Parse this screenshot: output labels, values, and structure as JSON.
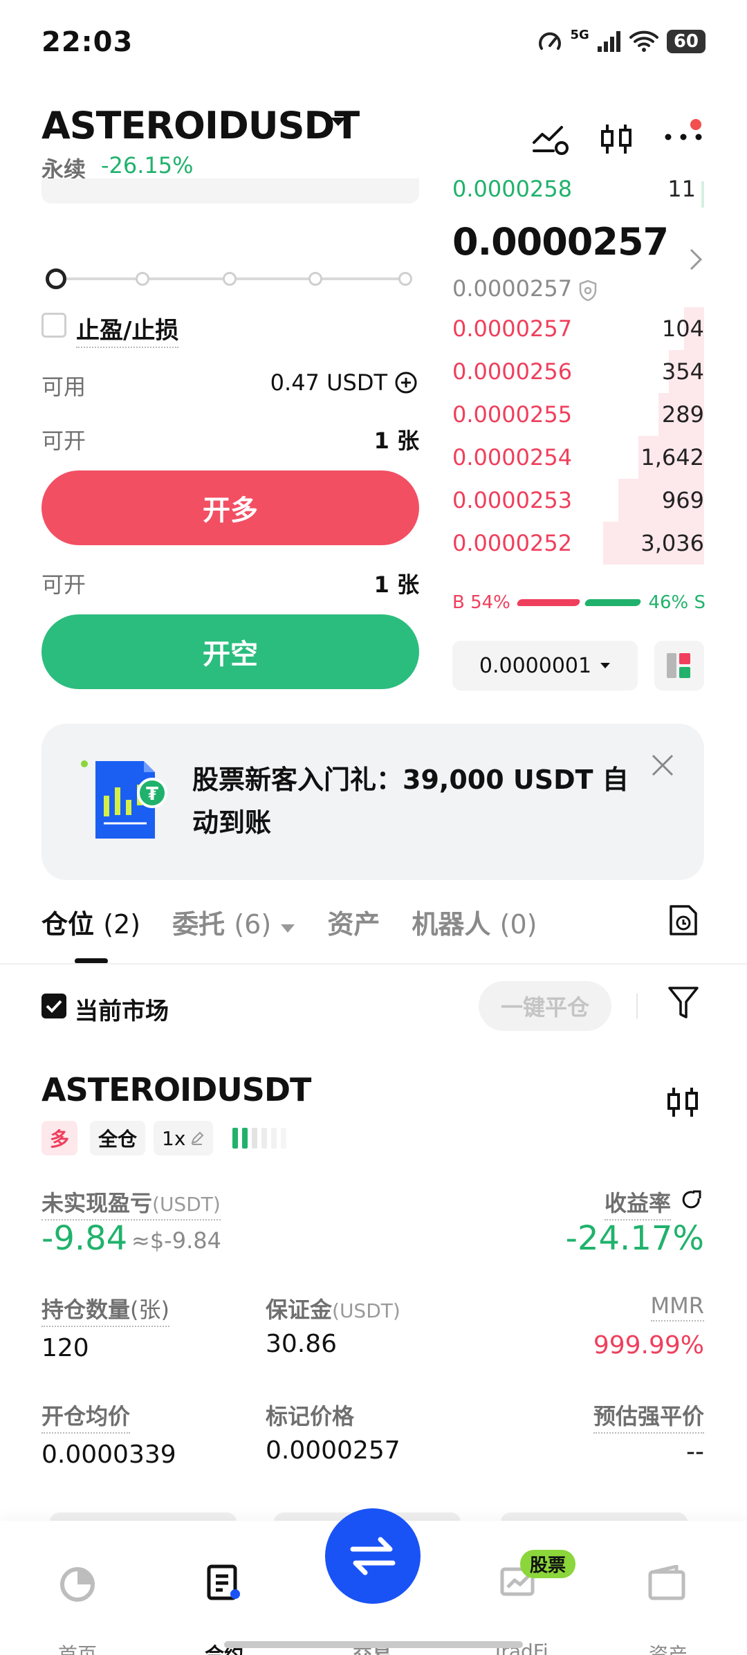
{
  "status_bar": {
    "time": "22:03",
    "network": "5G",
    "battery": "60"
  },
  "header": {
    "pair": "ASTEROIDUSDT",
    "perp_label": "永续",
    "change": "-26.15%"
  },
  "order_form": {
    "tp_sl_label": "止盈/止损",
    "available_label": "可用",
    "available_value": "0.47 USDT",
    "can_open_label": "可开",
    "can_open_long": "1 张",
    "can_open_short": "1 张",
    "long_button": "开多",
    "short_button": "开空",
    "leverage_slider_fraction": 0
  },
  "order_book": {
    "top_ask_price": "0.0000258",
    "top_ask_qty": "11",
    "last_price": "0.0000257",
    "mark_price": "0.0000257",
    "bids": [
      {
        "price": "0.0000257",
        "qty": "104",
        "depth": 0.08
      },
      {
        "price": "0.0000256",
        "qty": "354",
        "depth": 0.14
      },
      {
        "price": "0.0000255",
        "qty": "289",
        "depth": 0.18
      },
      {
        "price": "0.0000254",
        "qty": "1,642",
        "depth": 0.26
      },
      {
        "price": "0.0000253",
        "qty": "969",
        "depth": 0.34
      },
      {
        "price": "0.0000252",
        "qty": "3,036",
        "depth": 0.4
      }
    ],
    "buy_ratio": "B 54%",
    "sell_ratio": "46% S",
    "tick_size": "0.0000001"
  },
  "banner": {
    "text": "股票新客入门礼：39,000 USDT 自动到账"
  },
  "tabs": [
    {
      "label": "仓位",
      "count": "(2)"
    },
    {
      "label": "委托",
      "count": "(6)"
    },
    {
      "label": "资产",
      "count": ""
    },
    {
      "label": "机器人",
      "count": "(0)"
    }
  ],
  "filter": {
    "current_market_label": "当前市场",
    "close_all_label": "一键平仓"
  },
  "position": {
    "symbol": "ASTEROIDUSDT",
    "side_tag": "多",
    "margin_mode_tag": "全仓",
    "leverage_tag": "1x",
    "unrealized_pnl_label": "未实现盈亏",
    "unrealized_pnl_unit": "(USDT)",
    "unrealized_pnl": "-9.84",
    "unrealized_pnl_usd": "≈$-9.84",
    "roe_label": "收益率",
    "roe": "-24.17%",
    "size_label": "持仓数量",
    "size_unit": "(张)",
    "size": "120",
    "margin_label": "保证金",
    "margin_unit": "(USDT)",
    "margin": "30.86",
    "mmr_label": "MMR",
    "mmr": "999.99%",
    "entry_label": "开仓均价",
    "entry": "0.0000339",
    "mark_label": "标记价格",
    "mark": "0.0000257",
    "liq_label": "预估强平价",
    "liq": "--"
  },
  "bottom_nav": {
    "items": [
      "首页",
      "合约",
      "交易",
      "TradFi",
      "资产"
    ],
    "tradfi_badge": "股票"
  }
}
